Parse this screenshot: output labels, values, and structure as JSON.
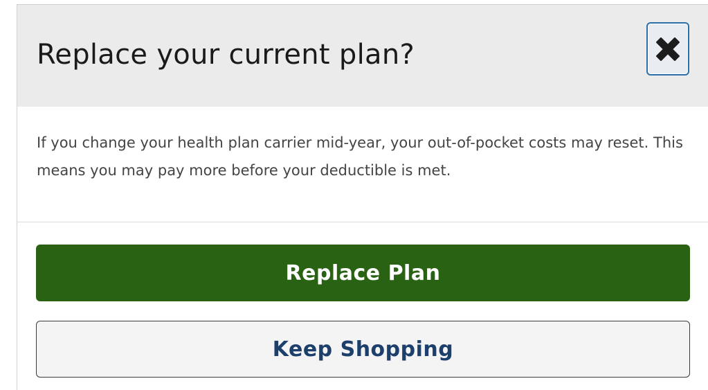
{
  "dialog": {
    "title": "Replace your current plan?",
    "message": "If you change your health plan carrier mid-year, your out-of-pocket costs may reset. This means you may pay more before your deductible is met.",
    "close_icon": "close-x-icon",
    "primary_label": "Replace Plan",
    "secondary_label": "Keep Shopping"
  },
  "colors": {
    "header_bg": "#ebebeb",
    "primary_bg": "#2a6214",
    "secondary_text": "#1d3f6b",
    "close_border": "#2c6ea8"
  }
}
